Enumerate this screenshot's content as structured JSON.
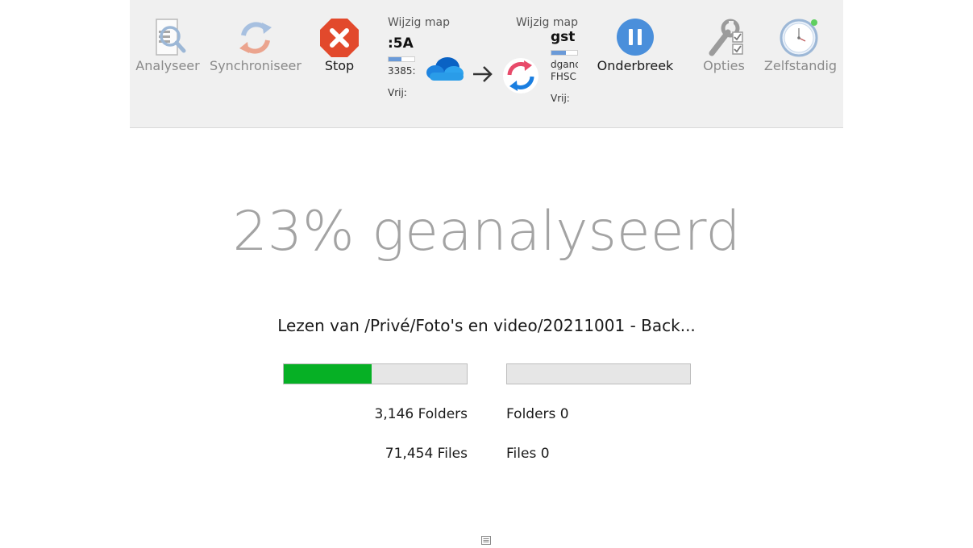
{
  "toolbar": {
    "analyse_label": "Analyseer",
    "sync_label": "Synchroniseer",
    "stop_label": "Stop",
    "pause_label": "Onderbreek",
    "options_label": "Opties",
    "standalone_label": "Zelfstandig",
    "source": {
      "change_folder": "Wijzig map",
      "name": ":5A",
      "size": "3385:",
      "free": "Vrij:",
      "fill": 0.5
    },
    "target": {
      "change_folder": "Wijzig map",
      "name": "gst",
      "line1": "dganc",
      "line2": "FHSC",
      "free": "Vrij:",
      "fill": 0.55
    }
  },
  "progress": {
    "headline": "23% geanalyseerd",
    "status": "Lezen van /Privé/Foto's en video/20211001 - Back...",
    "left_fill": 0.48,
    "right_fill": 0,
    "left_folders": "3,146 Folders",
    "left_files": "71,454 Files",
    "right_folders": "Folders 0",
    "right_files": "Files 0"
  },
  "colors": {
    "progress_green": "#06b025",
    "stop_red": "#e2492c",
    "pause_blue": "#4a8fdb",
    "onedrive_blue": "#0a6fd8"
  }
}
